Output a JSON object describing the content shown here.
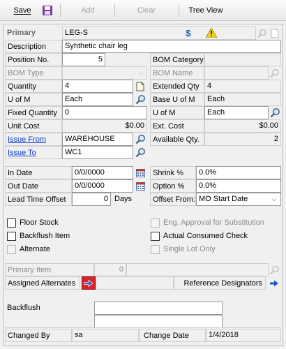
{
  "toolbar": {
    "save_label": "Save",
    "add_label": "Add",
    "clear_label": "Clear",
    "tree_view_label": "Tree View"
  },
  "form": {
    "primary_label": "Primary",
    "primary_value": "LEG-S",
    "description_label": "Description",
    "description_value": "Syhthetic chair leg",
    "position_no_label": "Position No.",
    "position_no_value": "5",
    "bom_category_label": "BOM Category",
    "bom_category_value": "",
    "bom_type_label": "BOM Type",
    "bom_type_value": "",
    "bom_name_label": "BOM Name",
    "bom_name_value": "",
    "quantity_label": "Quantity",
    "quantity_value": "4",
    "extended_qty_label": "Extended Qty",
    "extended_qty_value": "4",
    "u_of_m_label": "U of M",
    "u_of_m_value": "Each",
    "base_u_of_m_label": "Base U of M",
    "base_u_of_m_value": "Each",
    "fixed_quantity_label": "Fixed Quantity",
    "fixed_quantity_value": "0",
    "u_of_m_right_label": "U of M",
    "u_of_m_right_value": "Each",
    "unit_cost_label": "Unit Cost",
    "unit_cost_value": "$0.00",
    "ext_cost_label": "Ext. Cost",
    "ext_cost_value": "$0.00",
    "issue_from_label": "Issue From",
    "issue_from_value": "WAREHOUSE",
    "available_qty_label": "Available Qty.",
    "available_qty_value": "2",
    "issue_to_label": "Issue To",
    "issue_to_value": "WC1",
    "in_date_label": "In Date",
    "in_date_value": "0/0/0000",
    "shrink_label": "Shrink %",
    "shrink_value": "0.0%",
    "out_date_label": "Out Date",
    "out_date_value": "0/0/0000",
    "option_label": "Option %",
    "option_value": "0.0%",
    "lead_time_offset_label": "Lead Time Offset",
    "lead_time_offset_value": "0",
    "days_label": "Days",
    "offset_from_label": "Offset From:",
    "offset_from_value": "MO Start Date",
    "floor_stock_label": "Floor Stock",
    "eng_approval_label": "Eng. Approval for Substitution",
    "backflush_item_label": "Backflush Item",
    "actual_consumed_check_label": "Actual Consumed Check",
    "alternate_label": "Alternate",
    "single_lot_only_label": "Single Lot Only",
    "primary_item_label": "Primary Item",
    "primary_item_value": "0",
    "assigned_alternates_label": "Assigned Alternates",
    "reference_designators_label": "Reference Designators",
    "backflush_label": "Backflush",
    "changed_by_label": "Changed By",
    "changed_by_value": "sa",
    "change_date_label": "Change Date",
    "change_date_value": "1/4/2018"
  },
  "colors": {
    "link": "#0b3ecc",
    "currency_icon": "#1a5fb4",
    "warning_icon": "#f3d21b",
    "assigned_alternates_button": "#d8232a"
  }
}
